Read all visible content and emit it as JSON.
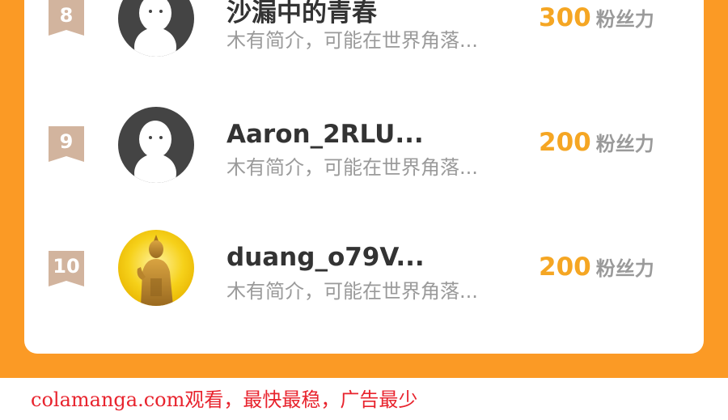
{
  "ranking": [
    {
      "rank": "8",
      "name": "沙漏中的青春",
      "bio": "木有简介，可能在世界角落...",
      "fans_value": "300",
      "fans_unit": "粉丝力",
      "avatar": "default-user-icon"
    },
    {
      "rank": "9",
      "name": "Aaron_2RLU...",
      "bio": "木有简介，可能在世界角落...",
      "fans_value": "200",
      "fans_unit": "粉丝力",
      "avatar": "default-user-icon"
    },
    {
      "rank": "10",
      "name": "duang_o79V...",
      "bio": "木有简介，可能在世界角落...",
      "fans_value": "200",
      "fans_unit": "粉丝力",
      "avatar": "buddha-photo"
    }
  ],
  "watermark": "colamanga.com观看，最快最稳，广告最少",
  "colors": {
    "accent": "#fb9a25",
    "fans_number": "#f5a623",
    "rank_badge": "#d2b49e",
    "watermark": "#e8232d"
  }
}
